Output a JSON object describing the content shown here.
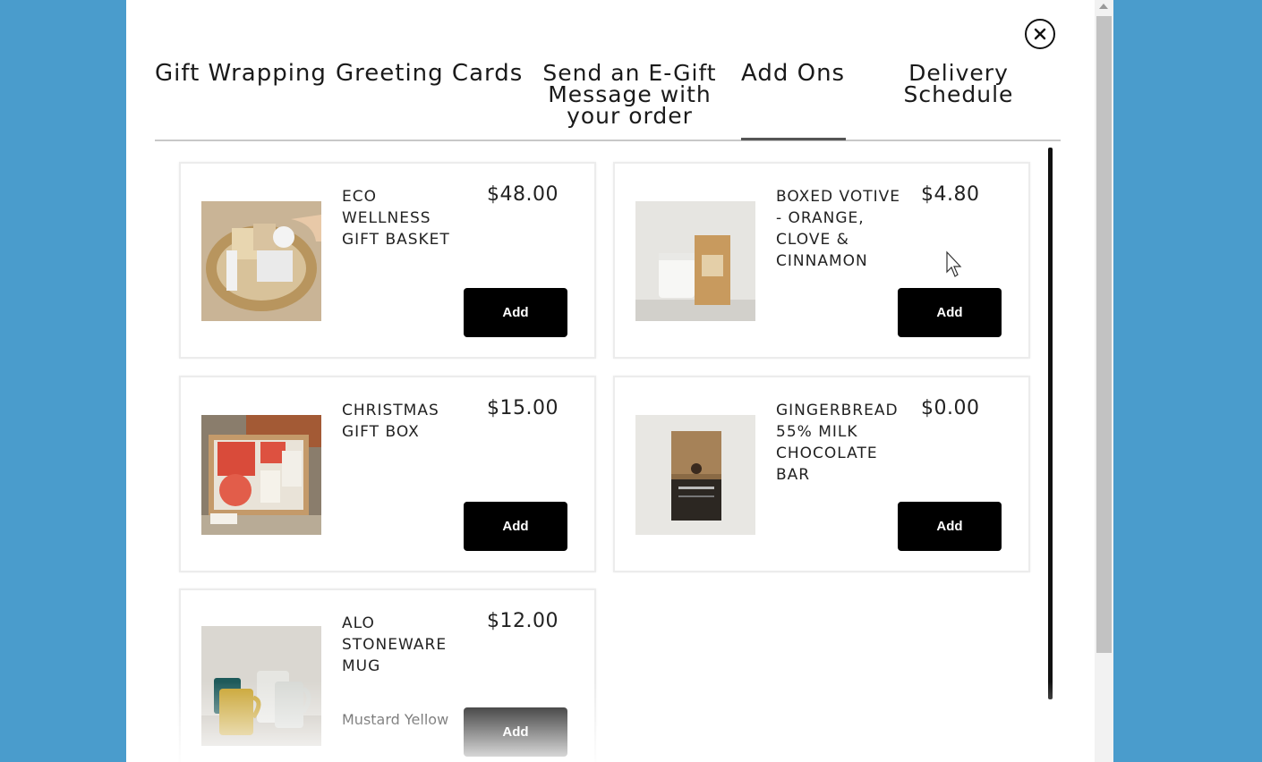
{
  "close": {
    "icon": "close-icon"
  },
  "tabs": [
    {
      "label": "Gift Wrapping"
    },
    {
      "label": "Greeting Cards"
    },
    {
      "label": "Send an E-Gift Message with your order"
    },
    {
      "label": "Add Ons",
      "active": true
    },
    {
      "label": "Delivery Schedule"
    }
  ],
  "products": [
    {
      "name": "ECO WELLNESS GIFT BASKET",
      "price": "$48.00",
      "button": "Add",
      "variant": ""
    },
    {
      "name": "BOXED VOTIVE - ORANGE, CLOVE & CINNAMON",
      "price": "$4.80",
      "button": "Add",
      "variant": ""
    },
    {
      "name": "CHRISTMAS GIFT BOX",
      "price": "$15.00",
      "button": "Add",
      "variant": ""
    },
    {
      "name": "GINGERBREAD 55% MILK CHOCOLATE BAR",
      "price": "$0.00",
      "button": "Add",
      "variant": ""
    },
    {
      "name": "ALO STONEWARE MUG",
      "price": "$12.00",
      "button": "Add",
      "variant": "Mustard Yellow"
    }
  ],
  "colors": {
    "background": "#4a9ccc",
    "modal": "#ffffff",
    "button": "#000000",
    "button_text": "#ffffff"
  }
}
